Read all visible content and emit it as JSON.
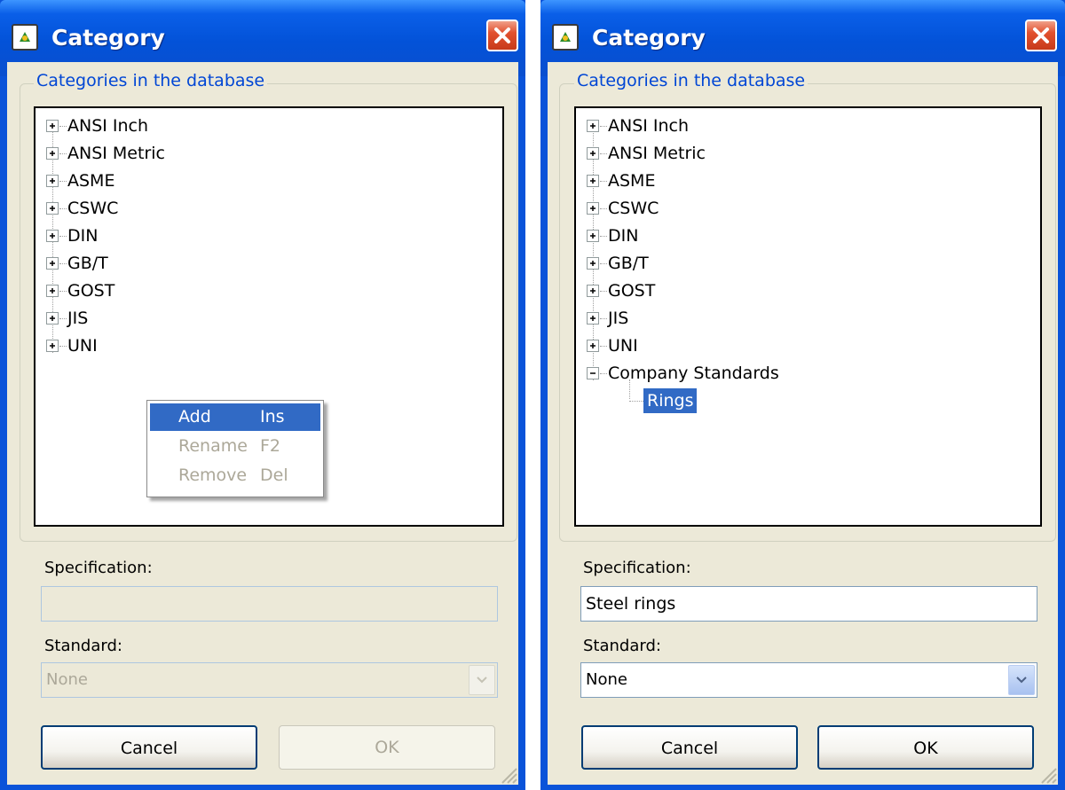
{
  "colors": {
    "frame_blue": "#0a53d9",
    "client_bg": "#ece9d8",
    "selection": "#316ac5",
    "legend_text": "#0046d5",
    "disabled_text": "#aca899"
  },
  "windows": [
    {
      "title": "Category",
      "app_icon": "category-app-icon",
      "close_icon": "close-icon",
      "group_label": "Categories in the database",
      "tree_items": [
        {
          "label": "ANSI Inch",
          "expander": "plus"
        },
        {
          "label": "ANSI Metric",
          "expander": "plus"
        },
        {
          "label": "ASME",
          "expander": "plus"
        },
        {
          "label": "CSWC",
          "expander": "plus"
        },
        {
          "label": "DIN",
          "expander": "plus"
        },
        {
          "label": "GB/T",
          "expander": "plus"
        },
        {
          "label": "GOST",
          "expander": "plus"
        },
        {
          "label": "JIS",
          "expander": "plus"
        },
        {
          "label": "UNI",
          "expander": "plus"
        }
      ],
      "context_menu": [
        {
          "label": "Add",
          "shortcut": "Ins",
          "state": "highlighted"
        },
        {
          "label": "Rename",
          "shortcut": "F2",
          "state": "disabled"
        },
        {
          "label": "Remove",
          "shortcut": "Del",
          "state": "disabled"
        }
      ],
      "specification": {
        "label": "Specification:",
        "value": "",
        "enabled": false
      },
      "standard": {
        "label": "Standard:",
        "value": "None",
        "enabled": false
      },
      "buttons": {
        "cancel": "Cancel",
        "ok": "OK",
        "ok_enabled": false
      }
    },
    {
      "title": "Category",
      "app_icon": "category-app-icon",
      "close_icon": "close-icon",
      "group_label": "Categories in the database",
      "tree_items": [
        {
          "label": "ANSI Inch",
          "expander": "plus"
        },
        {
          "label": "ANSI Metric",
          "expander": "plus"
        },
        {
          "label": "ASME",
          "expander": "plus"
        },
        {
          "label": "CSWC",
          "expander": "plus"
        },
        {
          "label": "DIN",
          "expander": "plus"
        },
        {
          "label": "GB/T",
          "expander": "plus"
        },
        {
          "label": "GOST",
          "expander": "plus"
        },
        {
          "label": "JIS",
          "expander": "plus"
        },
        {
          "label": "UNI",
          "expander": "plus"
        },
        {
          "label": "Company Standards",
          "expander": "minus"
        },
        {
          "label": "Rings",
          "expander": "none",
          "child": true,
          "selected": true
        }
      ],
      "specification": {
        "label": "Specification:",
        "value": "Steel rings",
        "enabled": true
      },
      "standard": {
        "label": "Standard:",
        "value": "None",
        "enabled": true
      },
      "buttons": {
        "cancel": "Cancel",
        "ok": "OK",
        "ok_enabled": true
      }
    }
  ]
}
